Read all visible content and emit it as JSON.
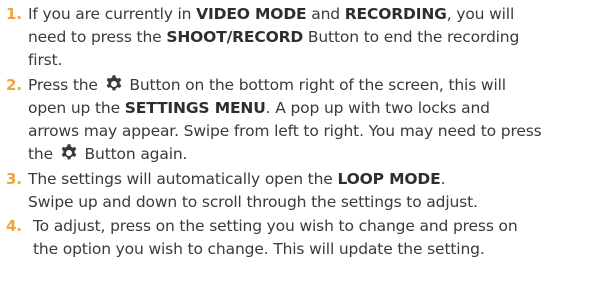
{
  "steps": [
    {
      "number": "1.",
      "lines": [
        [
          "If you are currently in ",
          "VIDEO MODE",
          " and ",
          "RECORDING",
          ", you will"
        ],
        [
          "need to press the ",
          "SHOOT/RECORD",
          " Button to end the recording"
        ],
        [
          "first."
        ]
      ]
    },
    {
      "number": "2.",
      "lines": [
        [
          "Press the ",
          "",
          " Button on the bottom right of the screen, this will"
        ],
        [
          "open up the ",
          "SETTINGS MENU",
          ". A pop up with two locks and"
        ],
        [
          "arrows may appear. Swipe from left to right. You may need to press"
        ],
        [
          "the ",
          "",
          " Button again."
        ]
      ]
    },
    {
      "number": "3.",
      "lines": [
        [
          "The settings will automatically open the ",
          "LOOP MODE",
          "."
        ],
        [
          "Swipe up and down to scroll through the settings to adjust."
        ]
      ]
    },
    {
      "number": "4.",
      "lines": [
        [
          "To adjust, press on the setting you wish to change and press on"
        ],
        [
          "the option you wish to change. This will update the setting."
        ]
      ]
    }
  ],
  "icon": "gear-icon",
  "accent_color": "#f2a23a"
}
